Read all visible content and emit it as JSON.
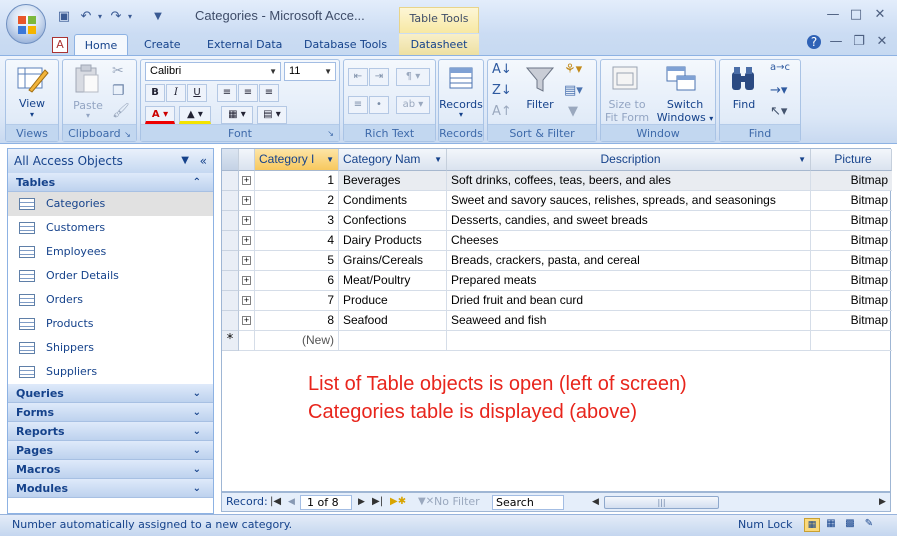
{
  "window": {
    "title": "Categories - Microsoft Acce...",
    "context_tab_group": "Table Tools"
  },
  "ribbon_tabs": [
    "Home",
    "Create",
    "External Data",
    "Database Tools",
    "Datasheet"
  ],
  "ribbon": {
    "views": {
      "label": "Views",
      "view_button": "View"
    },
    "clipboard": {
      "label": "Clipboard",
      "paste_button": "Paste"
    },
    "font": {
      "label": "Font",
      "font_name": "Calibri",
      "font_size": "11"
    },
    "rich_text": {
      "label": "Rich Text"
    },
    "records": {
      "label": "Records",
      "records_button": "Records"
    },
    "sort_filter": {
      "label": "Sort & Filter",
      "filter_button": "Filter"
    },
    "window": {
      "label": "Window",
      "size_to_fit": "Size to\nFit Form",
      "size_to_fit_l1": "Size to",
      "size_to_fit_l2": "Fit Form",
      "switch_l1": "Switch",
      "switch_l2": "Windows"
    },
    "find": {
      "label": "Find",
      "find_button": "Find"
    }
  },
  "nav_pane": {
    "header": "All Access Objects",
    "tables_section": "Tables",
    "tables": [
      "Categories",
      "Customers",
      "Employees",
      "Order Details",
      "Orders",
      "Products",
      "Shippers",
      "Suppliers"
    ],
    "selected_table": "Categories",
    "sections": [
      "Queries",
      "Forms",
      "Reports",
      "Pages",
      "Macros",
      "Modules"
    ]
  },
  "datasheet": {
    "columns": [
      "Category I",
      "Category Nam",
      "Description",
      "Picture"
    ],
    "rows": [
      {
        "id": "1",
        "name": "Beverages",
        "description": "Soft drinks, coffees, teas, beers, and ales",
        "picture": "Bitmap"
      },
      {
        "id": "2",
        "name": "Condiments",
        "description": "Sweet and savory sauces, relishes, spreads, and seasonings",
        "picture": "Bitmap"
      },
      {
        "id": "3",
        "name": "Confections",
        "description": "Desserts, candies, and sweet breads",
        "picture": "Bitmap"
      },
      {
        "id": "4",
        "name": "Dairy Products",
        "description": "Cheeses",
        "picture": "Bitmap"
      },
      {
        "id": "5",
        "name": "Grains/Cereals",
        "description": "Breads, crackers, pasta, and cereal",
        "picture": "Bitmap"
      },
      {
        "id": "6",
        "name": "Meat/Poultry",
        "description": "Prepared meats",
        "picture": "Bitmap"
      },
      {
        "id": "7",
        "name": "Produce",
        "description": "Dried fruit and bean curd",
        "picture": "Bitmap"
      },
      {
        "id": "8",
        "name": "Seafood",
        "description": "Seaweed and fish",
        "picture": "Bitmap"
      }
    ],
    "new_row_marker": "*",
    "new_row_label": "(New)"
  },
  "annotation": {
    "line1": "List of Table objects is open (left of screen)",
    "line2": "Categories table is displayed (above)"
  },
  "record_nav": {
    "label": "Record:",
    "position": "1 of 8",
    "filter": "No Filter",
    "search_placeholder": "Search"
  },
  "status_bar": {
    "message": "Number automatically assigned to a new category.",
    "num_lock": "Num Lock"
  },
  "colors": {
    "accent": "#15428b",
    "annotation": "#e8251c",
    "selected_header": "#f7d27e"
  }
}
